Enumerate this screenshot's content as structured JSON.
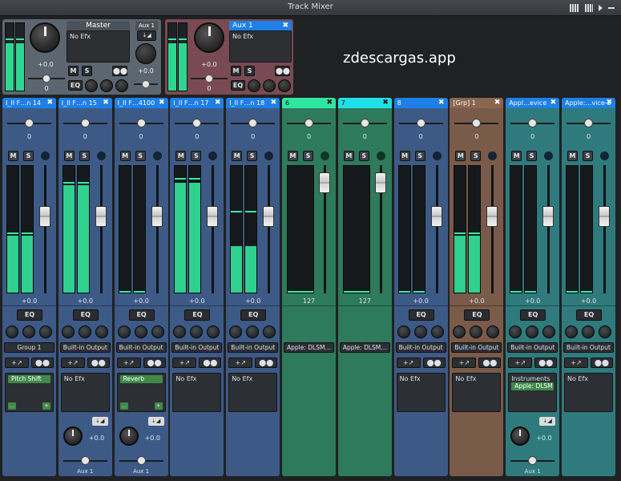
{
  "window": {
    "title": "Track Mixer"
  },
  "watermark": "zdescargas.app",
  "colors": {
    "accent_blue": "#1e7fe6",
    "accent_green": "#2ee6a0",
    "accent_cyan": "#1fe0e8",
    "strip_blue": "#3d5a86",
    "strip_green": "#2e7a5c",
    "strip_brown": "#7a5a48",
    "strip_teal": "#2f7a7c",
    "master_gray": "#5c6670",
    "aux_red": "#7a4a52",
    "meter_green": "#30d08e"
  },
  "master": {
    "title": "Master",
    "efx": "No Efx",
    "volume": "+0.0",
    "pan": "0",
    "aux_label": "Aux 1",
    "aux_volume": "+0.0",
    "buttons": {
      "m": "M",
      "s": "S",
      "eq": "EQ"
    }
  },
  "aux": {
    "title": "Aux 1",
    "efx": "No Efx",
    "volume": "+0.0",
    "pan": "0",
    "buttons": {
      "m": "M",
      "s": "S",
      "eq": "EQ"
    }
  },
  "tracks": [
    {
      "name": "I_II F…n 14",
      "pan": "0",
      "volume": "+0.0",
      "meter_level": 0.45,
      "peak": 0.46,
      "fader_level": 0.6,
      "output": "Group 1",
      "plugin": "Pitch Shift",
      "efx": "",
      "aux_value": "",
      "aux_label": "",
      "theme": "blue"
    },
    {
      "name": "I_II F…n 15",
      "pan": "0",
      "volume": "+0.0",
      "meter_level": 0.85,
      "peak": 0.86,
      "fader_level": 0.6,
      "output": "Built-in Output",
      "plugin": "",
      "efx": "No Efx",
      "aux_value": "+0.0",
      "aux_label": "Aux 1",
      "theme": "blue"
    },
    {
      "name": "I_II F…4100",
      "pan": "0",
      "volume": "+0.0",
      "meter_level": 0,
      "peak": 0,
      "fader_level": 0.6,
      "output": "Built-in Output",
      "plugin": "Reverb",
      "efx": "",
      "aux_value": "+0.0",
      "aux_label": "Aux 1",
      "theme": "blue"
    },
    {
      "name": "I_II F…n 17",
      "pan": "0",
      "volume": "+0.0",
      "meter_level": 0.87,
      "peak": 0.89,
      "fader_level": 0.6,
      "output": "Built-in Output",
      "plugin": "",
      "efx": "No Efx",
      "aux_value": "",
      "aux_label": "",
      "theme": "blue"
    },
    {
      "name": "I_II F…n 18",
      "pan": "0",
      "volume": "+0.0",
      "meter_level": 0.37,
      "peak": 0.63,
      "fader_level": 0.6,
      "output": "Built-in Output",
      "plugin": "",
      "efx": "No Efx",
      "aux_value": "",
      "aux_label": "",
      "theme": "blue"
    },
    {
      "name": "6",
      "pan": "0",
      "volume": "127",
      "meter_level": 0,
      "peak": 0,
      "fader_level": 0.86,
      "output": "Apple: DLSM…",
      "plugin": "",
      "efx": "",
      "aux_value": "",
      "aux_label": "",
      "theme": "green"
    },
    {
      "name": "7",
      "pan": "0",
      "volume": "127",
      "meter_level": 0,
      "peak": 0,
      "fader_level": 0.86,
      "output": "Apple: DLSM…",
      "plugin": "",
      "efx": "",
      "aux_value": "",
      "aux_label": "",
      "theme": "green"
    },
    {
      "name": "8",
      "pan": "0",
      "volume": "+0.0",
      "meter_level": 0,
      "peak": 0,
      "fader_level": 0.6,
      "output": "Built-in Output",
      "plugin": "",
      "efx": "No Efx",
      "aux_value": "",
      "aux_label": "",
      "theme": "blue"
    },
    {
      "name": "[Grp] 1",
      "pan": "0",
      "volume": "+0.0",
      "meter_level": 0.45,
      "peak": 0.46,
      "fader_level": 0.6,
      "output": "Built-in Output",
      "plugin": "",
      "efx": "No Efx",
      "aux_value": "",
      "aux_label": "",
      "theme": "brown"
    },
    {
      "name": "Appl…evice",
      "pan": "0",
      "volume": "+0.0",
      "meter_level": 0,
      "peak": 0,
      "fader_level": 0.6,
      "output": "Built-in Output",
      "plugin": "Apple: DLSM",
      "efx": "Instruments",
      "aux_value": "+0.0",
      "aux_label": "Aux 1",
      "theme": "teal"
    },
    {
      "name": "Apple:…vice-2",
      "pan": "0",
      "volume": "+0.0",
      "meter_level": 0,
      "peak": 0,
      "fader_level": 0.6,
      "output": "Built-in Output",
      "plugin": "",
      "efx": "No Efx",
      "aux_value": "",
      "aux_label": "",
      "theme": "teal"
    }
  ],
  "labels": {
    "m": "M",
    "s": "S",
    "eq": "EQ",
    "close": "✖",
    "more": "…",
    "add": "+"
  }
}
